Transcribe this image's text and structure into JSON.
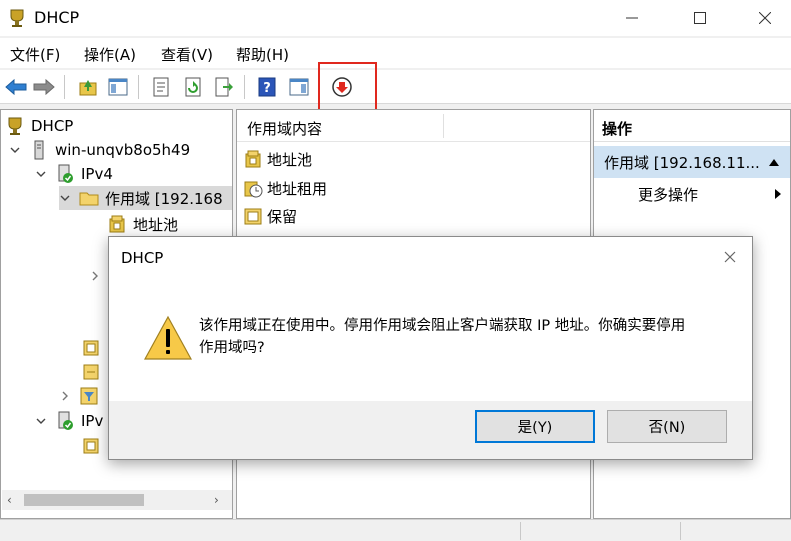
{
  "window": {
    "title": "DHCP"
  },
  "menu": {
    "items": [
      "文件(F)",
      "操作(A)",
      "查看(V)",
      "帮助(H)"
    ]
  },
  "toolbar": {
    "icons": [
      "back-arrow-icon",
      "forward-arrow-icon",
      "up-folder-icon",
      "show-hide-console-tree-icon",
      "properties-icon",
      "refresh-icon",
      "export-list-icon",
      "help-icon",
      "show-hide-action-pane-icon",
      "deactivate-icon"
    ]
  },
  "tree": {
    "root": "DHCP",
    "server": "win-unqvb8o5h49",
    "ipv4": "IPv4",
    "scope": "作用域 [192.168",
    "address_pool": "地址池",
    "ipv6_partial": "IPv"
  },
  "content": {
    "header": "作用域内容",
    "items": [
      "地址池",
      "地址租用",
      "保留"
    ]
  },
  "actions": {
    "header": "操作",
    "scope": "作用域 [192.168.11...",
    "more": "更多操作"
  },
  "dialog": {
    "title": "DHCP",
    "message_line1": "该作用域正在使用中。停用作用域会阻止客户端获取 IP 地址。你确实要停用",
    "message_line2": "作用域吗?",
    "yes_label": "是(Y)",
    "no_label": "否(N)"
  },
  "colors": {
    "selection": "#cfe2f3",
    "highlight_box": "#e0281e",
    "primary_button_border": "#0078d7"
  }
}
